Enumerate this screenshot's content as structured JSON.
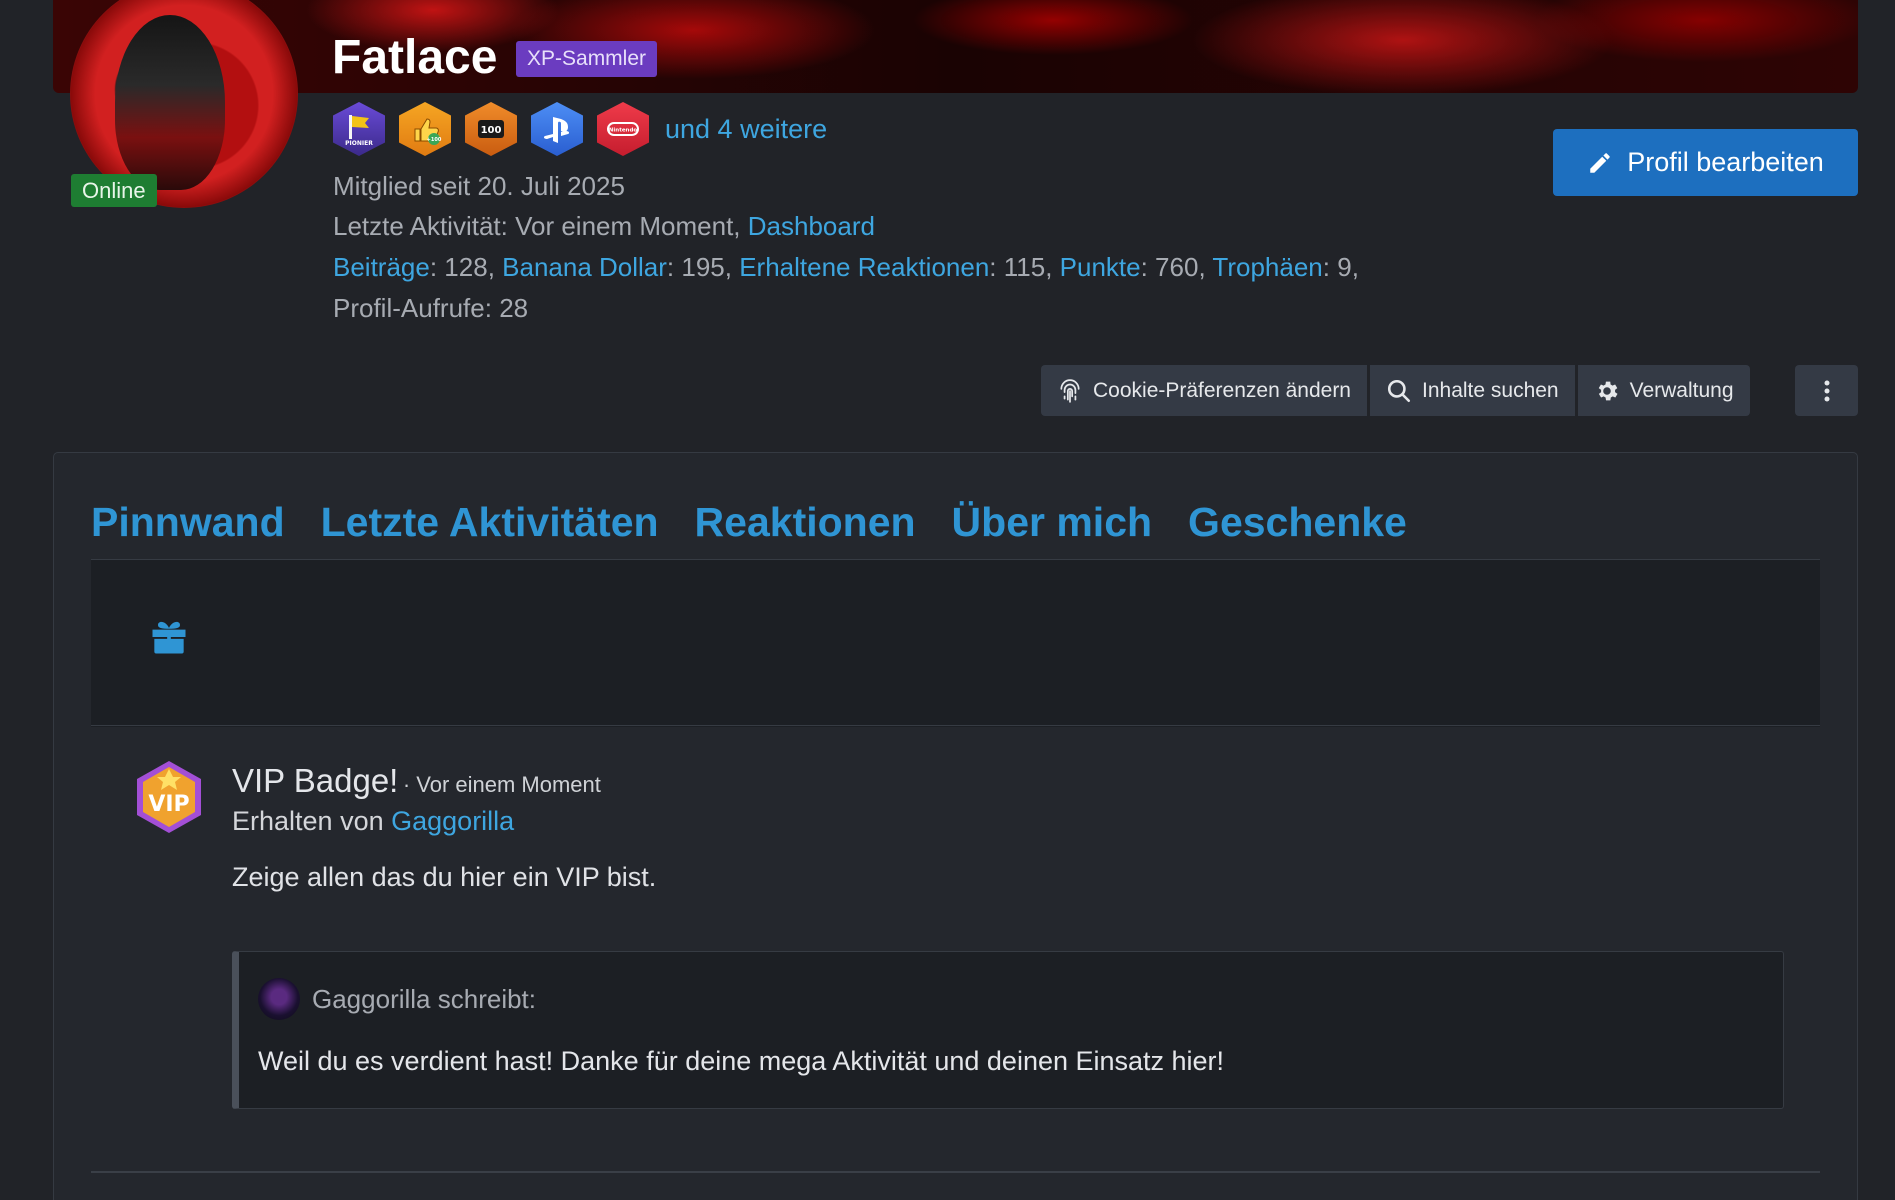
{
  "profile": {
    "username": "Fatlace",
    "user_title": "XP-Sammler",
    "status": "Online",
    "more_badges": "und 4 weitere",
    "badges": [
      "PIONIER",
      "+100",
      "100",
      "PlayStation",
      "Nintendo"
    ],
    "member_since": "Mitglied seit 20. Juli 2025",
    "last_activity_label": "Letzte Aktivität: Vor einem Moment,",
    "last_activity_link": "Dashboard",
    "stats": [
      {
        "label": "Beiträge",
        "value": "128"
      },
      {
        "label": "Banana Dollar",
        "value": "195"
      },
      {
        "label": "Erhaltene Reaktionen",
        "value": "115"
      },
      {
        "label": "Punkte",
        "value": "760"
      },
      {
        "label": "Trophäen",
        "value": "9"
      }
    ],
    "profile_views_label": "Profil-Aufrufe",
    "profile_views_value": "28",
    "edit_button": "Profil bearbeiten"
  },
  "actions": {
    "cookie": "Cookie-Präferenzen ändern",
    "search": "Inhalte suchen",
    "manage": "Verwaltung"
  },
  "tabs": [
    {
      "label": "Pinnwand"
    },
    {
      "label": "Letzte Aktivitäten"
    },
    {
      "label": "Reaktionen"
    },
    {
      "label": "Über mich"
    },
    {
      "label": "Geschenke",
      "active": true
    }
  ],
  "gift": {
    "title": "VIP Badge!",
    "time": "· Vor einem Moment",
    "from_label": "Erhalten von",
    "from_user": "Gaggorilla",
    "message": "Zeige allen das du hier ein VIP bist.",
    "badge_text": "VIP",
    "quote": {
      "author": "Gaggorilla schreibt:",
      "text": "Weil du es verdient hast! Danke für deine mega Aktivität und deinen Einsatz hier!"
    }
  },
  "colors": {
    "accent": "#2f95d4",
    "link": "#3ea6e0",
    "online": "#1e7d32",
    "title_badge": "#6b3cc0",
    "edit_button": "#1d6fbf"
  }
}
